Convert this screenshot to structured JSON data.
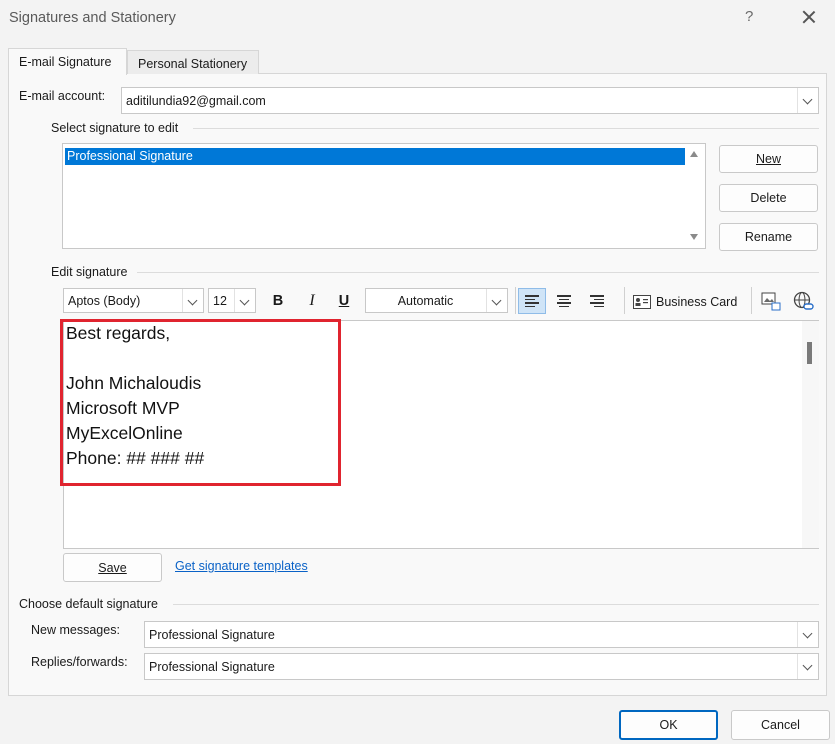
{
  "window": {
    "title": "Signatures and Stationery",
    "help": "?"
  },
  "tabs": [
    {
      "label": "E-mail Signature",
      "active": true
    },
    {
      "label": "Personal Stationery",
      "active": false
    }
  ],
  "email_account": {
    "label": "E-mail account:",
    "value": "aditilundia92@gmail.com"
  },
  "select_signature": {
    "group_label": "Select signature to edit",
    "items": [
      "Professional Signature"
    ],
    "selected": "Professional Signature"
  },
  "signature_buttons": {
    "new": "New",
    "delete": "Delete",
    "rename": "Rename"
  },
  "edit_signature": {
    "group_label": "Edit signature",
    "font": "Aptos (Body)",
    "size": "12",
    "bold": "B",
    "italic": "I",
    "underline": "U",
    "color": "Automatic",
    "business_card": "Business Card",
    "lines": [
      "Best regards,",
      "",
      "John Michaloudis",
      "Microsoft MVP",
      "MyExcelOnline",
      "Phone: ## ### ##"
    ]
  },
  "save_button": "Save",
  "templates_link": "Get signature templates",
  "default_signature": {
    "group_label": "Choose default signature",
    "new_messages_label": "New messages:",
    "new_messages_value": "Professional Signature",
    "replies_label": "Replies/forwards:",
    "replies_value": "Professional Signature"
  },
  "dialog_buttons": {
    "ok": "OK",
    "cancel": "Cancel"
  },
  "colors": {
    "highlight": "#0078d7",
    "annotation": "#e0242f",
    "link": "#0a62c7"
  }
}
